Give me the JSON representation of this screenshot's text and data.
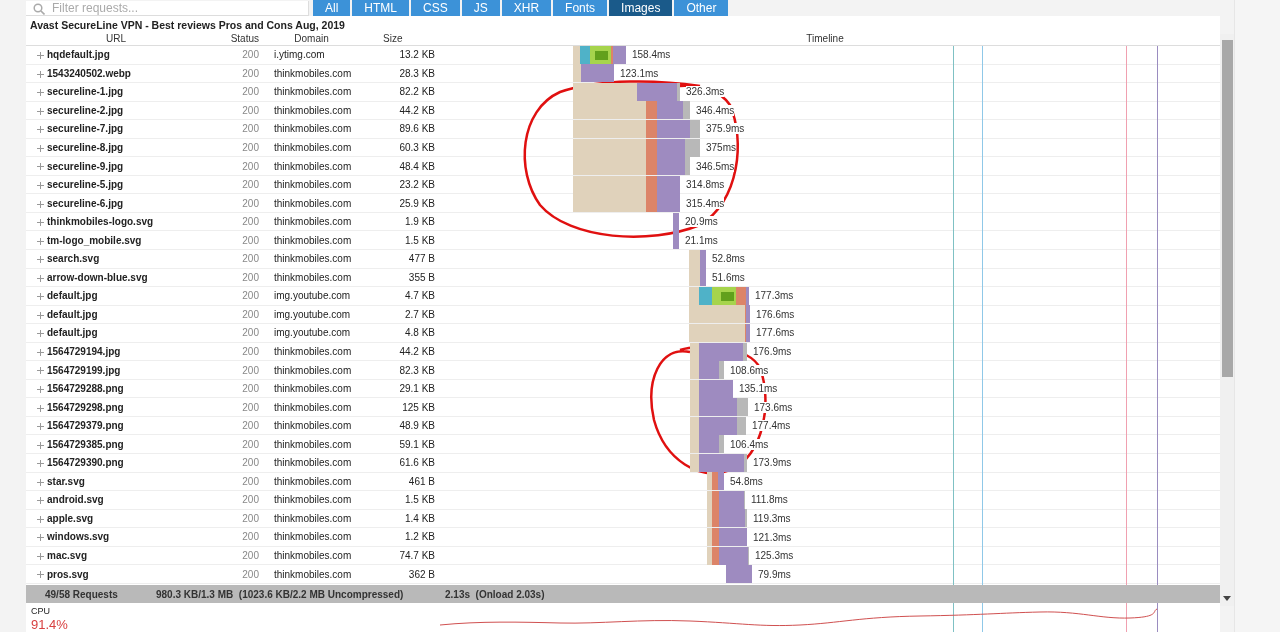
{
  "filter": {
    "placeholder": "Filter requests..."
  },
  "type_tabs": [
    {
      "label": "All",
      "selected": false
    },
    {
      "label": "HTML",
      "selected": false
    },
    {
      "label": "CSS",
      "selected": false
    },
    {
      "label": "JS",
      "selected": false
    },
    {
      "label": "XHR",
      "selected": false
    },
    {
      "label": "Fonts",
      "selected": false
    },
    {
      "label": "Images",
      "selected": true
    },
    {
      "label": "Other",
      "selected": false
    }
  ],
  "page_title": "Avast SecureLine VPN - Best reviews Pros and Cons Aug, 2019",
  "table": {
    "columns": [
      "URL",
      "Status",
      "Domain",
      "Size",
      "Timeline"
    ],
    "rows": [
      {
        "url": "hqdefault.jpg",
        "status": "200",
        "domain": "i.ytimg.com",
        "size": "13.2 KB",
        "time": "158.4ms"
      },
      {
        "url": "1543240502.webp",
        "status": "200",
        "domain": "thinkmobiles.com",
        "size": "28.3 KB",
        "time": "123.1ms"
      },
      {
        "url": "secureline-1.jpg",
        "status": "200",
        "domain": "thinkmobiles.com",
        "size": "82.2 KB",
        "time": "326.3ms"
      },
      {
        "url": "secureline-2.jpg",
        "status": "200",
        "domain": "thinkmobiles.com",
        "size": "44.2 KB",
        "time": "346.4ms"
      },
      {
        "url": "secureline-7.jpg",
        "status": "200",
        "domain": "thinkmobiles.com",
        "size": "89.6 KB",
        "time": "375.9ms"
      },
      {
        "url": "secureline-8.jpg",
        "status": "200",
        "domain": "thinkmobiles.com",
        "size": "60.3 KB",
        "time": "375ms"
      },
      {
        "url": "secureline-9.jpg",
        "status": "200",
        "domain": "thinkmobiles.com",
        "size": "48.4 KB",
        "time": "346.5ms"
      },
      {
        "url": "secureline-5.jpg",
        "status": "200",
        "domain": "thinkmobiles.com",
        "size": "23.2 KB",
        "time": "314.8ms"
      },
      {
        "url": "secureline-6.jpg",
        "status": "200",
        "domain": "thinkmobiles.com",
        "size": "25.9 KB",
        "time": "315.4ms"
      },
      {
        "url": "thinkmobiles-logo.svg",
        "status": "200",
        "domain": "thinkmobiles.com",
        "size": "1.9 KB",
        "time": "20.9ms"
      },
      {
        "url": "tm-logo_mobile.svg",
        "status": "200",
        "domain": "thinkmobiles.com",
        "size": "1.5 KB",
        "time": "21.1ms"
      },
      {
        "url": "search.svg",
        "status": "200",
        "domain": "thinkmobiles.com",
        "size": "477 B",
        "time": "52.8ms"
      },
      {
        "url": "arrow-down-blue.svg",
        "status": "200",
        "domain": "thinkmobiles.com",
        "size": "355 B",
        "time": "51.6ms"
      },
      {
        "url": "default.jpg",
        "status": "200",
        "domain": "img.youtube.com",
        "size": "4.7 KB",
        "time": "177.3ms"
      },
      {
        "url": "default.jpg",
        "status": "200",
        "domain": "img.youtube.com",
        "size": "2.7 KB",
        "time": "176.6ms"
      },
      {
        "url": "default.jpg",
        "status": "200",
        "domain": "img.youtube.com",
        "size": "4.8 KB",
        "time": "177.6ms"
      },
      {
        "url": "1564729194.jpg",
        "status": "200",
        "domain": "thinkmobiles.com",
        "size": "44.2 KB",
        "time": "176.9ms"
      },
      {
        "url": "1564729199.jpg",
        "status": "200",
        "domain": "thinkmobiles.com",
        "size": "82.3 KB",
        "time": "108.6ms"
      },
      {
        "url": "1564729288.png",
        "status": "200",
        "domain": "thinkmobiles.com",
        "size": "29.1 KB",
        "time": "135.1ms"
      },
      {
        "url": "1564729298.png",
        "status": "200",
        "domain": "thinkmobiles.com",
        "size": "125 KB",
        "time": "173.6ms"
      },
      {
        "url": "1564729379.png",
        "status": "200",
        "domain": "thinkmobiles.com",
        "size": "48.9 KB",
        "time": "177.4ms"
      },
      {
        "url": "1564729385.png",
        "status": "200",
        "domain": "thinkmobiles.com",
        "size": "59.1 KB",
        "time": "106.4ms"
      },
      {
        "url": "1564729390.png",
        "status": "200",
        "domain": "thinkmobiles.com",
        "size": "61.6 KB",
        "time": "173.9ms"
      },
      {
        "url": "star.svg",
        "status": "200",
        "domain": "thinkmobiles.com",
        "size": "461 B",
        "time": "54.8ms"
      },
      {
        "url": "android.svg",
        "status": "200",
        "domain": "thinkmobiles.com",
        "size": "1.5 KB",
        "time": "111.8ms"
      },
      {
        "url": "apple.svg",
        "status": "200",
        "domain": "thinkmobiles.com",
        "size": "1.4 KB",
        "time": "119.3ms"
      },
      {
        "url": "windows.svg",
        "status": "200",
        "domain": "thinkmobiles.com",
        "size": "1.2 KB",
        "time": "121.3ms"
      },
      {
        "url": "mac.svg",
        "status": "200",
        "domain": "thinkmobiles.com",
        "size": "74.7 KB",
        "time": "125.3ms"
      },
      {
        "url": "pros.svg",
        "status": "200",
        "domain": "thinkmobiles.com",
        "size": "362 B",
        "time": "79.9ms"
      }
    ]
  },
  "status_bar": {
    "requests": "49/58 Requests",
    "transferred": "980.3 KB/1.3 MB  (1023.6 KB/2.2 MB Uncompressed)",
    "load_time": "2.13s  (Onload 2.03s)"
  },
  "cpu": {
    "label": "CPU",
    "value": "91.4%"
  },
  "annotations": [
    {
      "kind": "circle"
    },
    {
      "kind": "circle"
    }
  ]
}
